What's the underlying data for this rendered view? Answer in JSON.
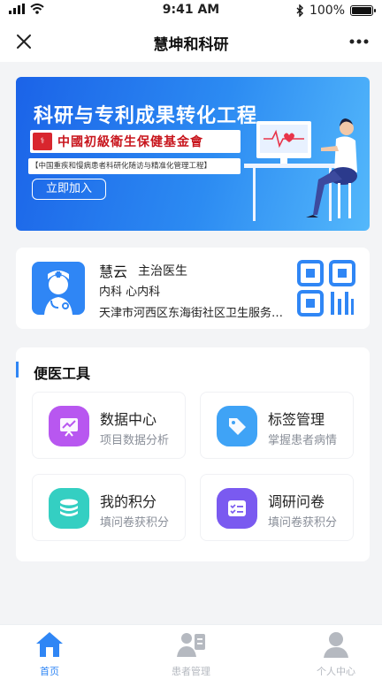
{
  "status_bar": {
    "time": "9:41 AM",
    "battery": "100%",
    "battery_level": 1.0
  },
  "nav": {
    "title": "慧坤和科研"
  },
  "banner": {
    "title": "科研与专利成果转化工程",
    "org": "中國初級衛生保健基金會",
    "subtitle": "【中国重疾和慢病患者科研化随访与精准化管理工程】",
    "button": "立即加入"
  },
  "doctor": {
    "name": "慧云",
    "title": "主治医生",
    "dept": "内科   心内科",
    "hospital": "天津市河西区东海街社区卫生服务中心"
  },
  "tools": {
    "title": "便医工具",
    "items": [
      {
        "name": "数据中心",
        "desc": "项目数据分析",
        "icon": "chart-board-icon",
        "color": "#b857f0"
      },
      {
        "name": "标签管理",
        "desc": "掌握患者病情",
        "icon": "tag-icon",
        "color": "#3fa3f6"
      },
      {
        "name": "我的积分",
        "desc": "填问卷获积分",
        "icon": "coins-stack-icon",
        "color": "#34cfc2"
      },
      {
        "name": "调研问卷",
        "desc": "填问卷获积分",
        "icon": "checklist-icon",
        "color": "#7a5af0"
      }
    ]
  },
  "tabbar": {
    "active_color": "#2f86f5",
    "inactive_color": "#b5b9c0",
    "items": [
      {
        "label": "首页",
        "icon": "home-icon",
        "active": true
      },
      {
        "label": "患者管理",
        "icon": "patients-icon",
        "active": false
      },
      {
        "label": "个人中心",
        "icon": "person-icon",
        "active": false
      }
    ]
  }
}
